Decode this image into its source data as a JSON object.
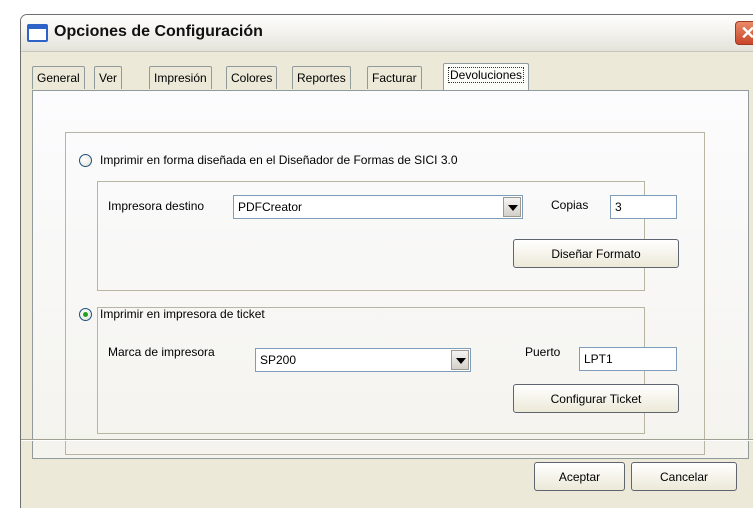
{
  "window": {
    "title": "Opciones de Configuración",
    "close_glyph": "✕"
  },
  "tabs": [
    {
      "label": "General"
    },
    {
      "label": "Ver"
    },
    {
      "label": "Impresión"
    },
    {
      "label": "Colores"
    },
    {
      "label": "Reportes"
    },
    {
      "label": "Facturar"
    },
    {
      "label": "Devoluciones",
      "active": true
    }
  ],
  "option_designed": {
    "label": "Imprimir en forma diseñada en el Diseñador de Formas de SICI 3.0",
    "checked": false,
    "printer_label": "Impresora destino",
    "printer_value": "PDFCreator",
    "copies_label": "Copias",
    "copies_value": "3",
    "design_button": "Diseñar Formato"
  },
  "option_ticket": {
    "label": "Imprimir en impresora de ticket",
    "checked": true,
    "brand_label": "Marca de impresora",
    "brand_value": "SP200",
    "port_label": "Puerto",
    "port_value": "LPT1",
    "config_button": "Configurar Ticket"
  },
  "footer": {
    "accept_label": "Aceptar",
    "cancel_label": "Cancelar"
  }
}
